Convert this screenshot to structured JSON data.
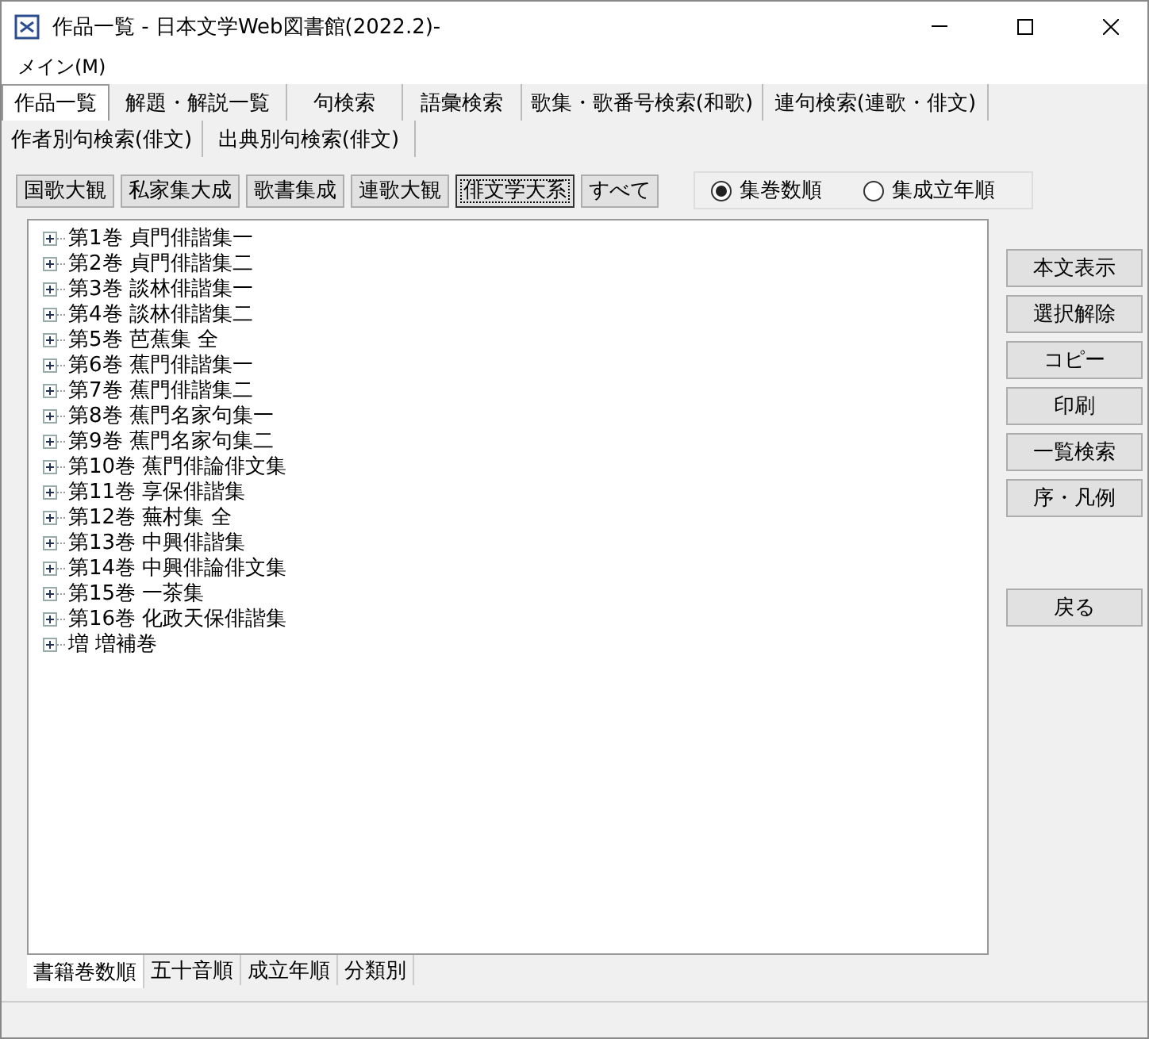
{
  "window": {
    "title": "作品一覧 - 日本文学Web図書館(2022.2)-"
  },
  "menu": [
    "メイン(M)"
  ],
  "tab_rows": [
    [
      {
        "label": "作品一覧",
        "selected": true
      },
      {
        "label": "解題・解説一覧",
        "selected": false
      },
      {
        "label": "句検索",
        "selected": false
      },
      {
        "label": "語彙検索",
        "selected": false
      },
      {
        "label": "歌集・歌番号検索(和歌)",
        "selected": false
      },
      {
        "label": "連句検索(連歌・俳文)",
        "selected": false
      }
    ],
    [
      {
        "label": "作者別句検索(俳文)",
        "selected": false
      },
      {
        "label": "出典別句検索(俳文)",
        "selected": false
      }
    ]
  ],
  "collections": [
    {
      "label": "国歌大観",
      "selected": false
    },
    {
      "label": "私家集大成",
      "selected": false
    },
    {
      "label": "歌書集成",
      "selected": false
    },
    {
      "label": "連歌大観",
      "selected": false
    },
    {
      "label": "俳文学大系",
      "selected": true
    },
    {
      "label": "すべて",
      "selected": false
    }
  ],
  "sort_options": [
    {
      "label": "集巻数順",
      "selected": true
    },
    {
      "label": "集成立年順",
      "selected": false
    }
  ],
  "tree": [
    {
      "label": "第1巻 貞門俳諧集一",
      "expanded": false
    },
    {
      "label": "第2巻 貞門俳諧集二",
      "expanded": false
    },
    {
      "label": "第3巻 談林俳諧集一",
      "expanded": false
    },
    {
      "label": "第4巻 談林俳諧集二",
      "expanded": false
    },
    {
      "label": "第5巻 芭蕉集 全",
      "expanded": false
    },
    {
      "label": "第6巻 蕉門俳諧集一",
      "expanded": false
    },
    {
      "label": "第7巻 蕉門俳諧集二",
      "expanded": false
    },
    {
      "label": "第8巻 蕉門名家句集一",
      "expanded": false
    },
    {
      "label": "第9巻 蕉門名家句集二",
      "expanded": false
    },
    {
      "label": "第10巻 蕉門俳論俳文集",
      "expanded": false
    },
    {
      "label": "第11巻 享保俳諧集",
      "expanded": false
    },
    {
      "label": "第12巻 蕪村集 全",
      "expanded": false
    },
    {
      "label": "第13巻 中興俳諧集",
      "expanded": false
    },
    {
      "label": "第14巻 中興俳論俳文集",
      "expanded": false
    },
    {
      "label": "第15巻 一茶集",
      "expanded": false
    },
    {
      "label": "第16巻 化政天保俳諧集",
      "expanded": false
    },
    {
      "label": "増 増補巻",
      "expanded": false
    }
  ],
  "actions": [
    "本文表示",
    "選択解除",
    "コピー",
    "印刷",
    "一覧検索",
    "序・凡例"
  ],
  "back_button": "戻る",
  "bottom_tabs": [
    {
      "label": "書籍巻数順",
      "selected": true
    },
    {
      "label": "五十音順",
      "selected": false
    },
    {
      "label": "成立年順",
      "selected": false
    },
    {
      "label": "分類別",
      "selected": false
    }
  ]
}
